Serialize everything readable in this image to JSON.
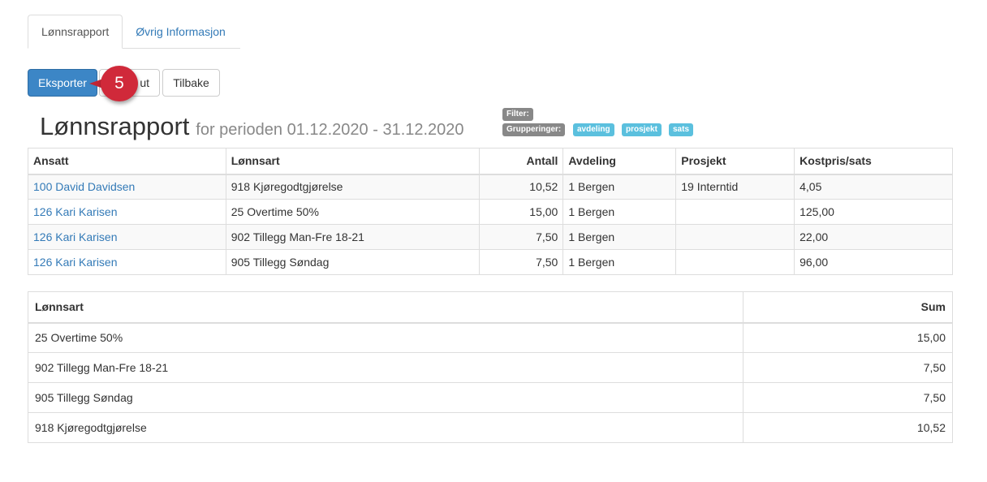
{
  "tabs": [
    {
      "label": "Lønnsrapport",
      "active": true
    },
    {
      "label": "Øvrig Informasjon",
      "active": false
    }
  ],
  "toolbar": {
    "export_label": "Eksporter",
    "partial_label": "ut",
    "back_label": "Tilbake"
  },
  "callout": {
    "number": "5",
    "color": "#d0293a"
  },
  "heading": {
    "title": "Lønnsrapport",
    "subtitle": "for perioden 01.12.2020 - 31.12.2020"
  },
  "filter": {
    "filter_label": "Filter:",
    "grouping_label": "Grupperinger:",
    "groupings": [
      "avdeling",
      "prosjekt",
      "sats"
    ]
  },
  "detail_table": {
    "headers": [
      "Ansatt",
      "Lønnsart",
      "Antall",
      "Avdeling",
      "Prosjekt",
      "Kostpris/sats"
    ],
    "rows": [
      [
        "100 David Davidsen",
        "918 Kjøregodtgjørelse",
        "10,52",
        "1 Bergen",
        "19 Interntid",
        "4,05"
      ],
      [
        "126 Kari Karisen",
        "25 Overtime 50%",
        "15,00",
        "1 Bergen",
        "",
        "125,00"
      ],
      [
        "126 Kari Karisen",
        "902 Tillegg Man-Fre 18-21",
        "7,50",
        "1 Bergen",
        "",
        "22,00"
      ],
      [
        "126 Kari Karisen",
        "905 Tillegg Søndag",
        "7,50",
        "1 Bergen",
        "",
        "96,00"
      ]
    ]
  },
  "summary_table": {
    "headers": [
      "Lønnsart",
      "Sum"
    ],
    "rows": [
      [
        "25 Overtime 50%",
        "15,00"
      ],
      [
        "902 Tillegg Man-Fre 18-21",
        "7,50"
      ],
      [
        "905 Tillegg Søndag",
        "7,50"
      ],
      [
        "918 Kjøregodtgjørelse",
        "10,52"
      ]
    ]
  },
  "colors": {
    "primary": "#3c86c6",
    "link": "#337ab7",
    "label_gray": "#888888",
    "label_info": "#5bc0de"
  }
}
